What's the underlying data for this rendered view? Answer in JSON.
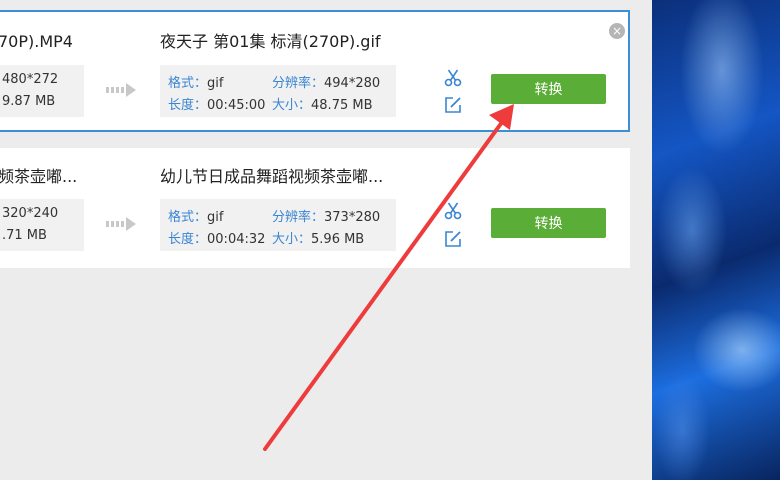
{
  "tasks": [
    {
      "source_name": "70P).MP4",
      "source_resolution": "480*272",
      "source_size": "9.87 MB",
      "output_name": "夜天子 第01集 标清(270P).gif",
      "format_label": "格式：",
      "format_value": "gif",
      "resolution_label": "分辨率：",
      "resolution_value": "494*280",
      "duration_label": "长度：",
      "duration_value": "00:45:00",
      "size_label": "大小：",
      "size_value": "48.75 MB",
      "convert_label": "转换"
    },
    {
      "source_name": "频茶壶嘟...",
      "source_resolution": "320*240",
      "source_size": ".71 MB",
      "output_name": "幼儿节日成品舞蹈视频茶壶嘟...",
      "format_label": "格式：",
      "format_value": "gif",
      "resolution_label": "分辨率：",
      "resolution_value": "373*280",
      "duration_label": "长度：",
      "duration_value": "00:04:32",
      "size_label": "大小：",
      "size_value": "5.96 MB",
      "convert_label": "转换"
    }
  ],
  "close_symbol": "×",
  "icons": {
    "arrow": "double-chevron-right-icon",
    "cut": "scissors-icon",
    "edit": "edit-icon",
    "close": "close-icon"
  },
  "colors": {
    "accent_blue": "#3a85d3",
    "convert_green": "#5aad36",
    "annotation_red": "#ee3b3b"
  }
}
